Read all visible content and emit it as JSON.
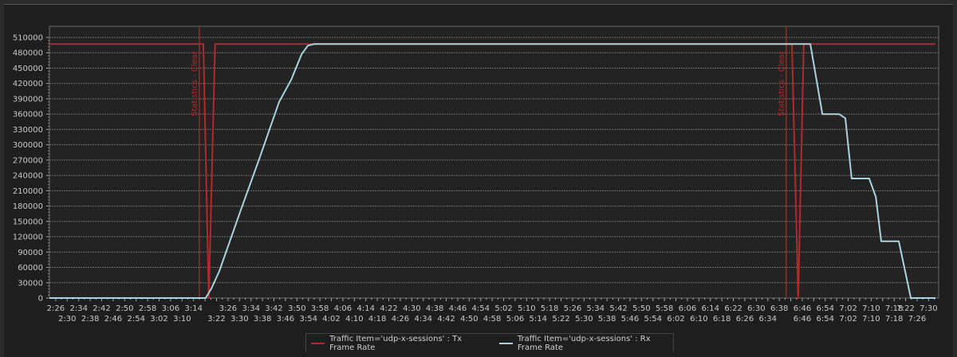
{
  "chart_data": {
    "type": "line",
    "title": "",
    "xlabel": "",
    "ylabel": "",
    "x_units": "minutes since 0:00",
    "xlim": [
      143.8,
      453.5
    ],
    "ylim": [
      0,
      527000
    ],
    "grid": true,
    "legend_position": "bottom-center",
    "yticks": [
      0,
      30000,
      60000,
      90000,
      120000,
      150000,
      180000,
      210000,
      240000,
      270000,
      300000,
      330000,
      360000,
      390000,
      420000,
      450000,
      480000,
      510000
    ],
    "xticks_row1": [
      "2:26",
      "2:34",
      "2:42",
      "2:50",
      "2:58",
      "3:06",
      "3:14",
      "3:26",
      "3:34",
      "3:42",
      "3:50",
      "3:58",
      "4:06",
      "4:14",
      "4:22",
      "4:30",
      "4:38",
      "4:46",
      "4:54",
      "5:02",
      "5:10",
      "5:18",
      "5:26",
      "5:34",
      "5:42",
      "5:50",
      "5:58",
      "6:06",
      "6:14",
      "6:22",
      "6:30",
      "6:38",
      "6:46",
      "6:54",
      "7:02",
      "7:10",
      "7:18",
      "7:22",
      "7:30"
    ],
    "xticks_row2": [
      "2:30",
      "2:38",
      "2:46",
      "2:54",
      "3:02",
      "3:10",
      "3:22",
      "3:30",
      "3:38",
      "3:46",
      "3:54",
      "4:02",
      "4:10",
      "4:18",
      "4:26",
      "4:34",
      "4:42",
      "4:50",
      "4:58",
      "5:06",
      "5:14",
      "5:22",
      "5:30",
      "5:38",
      "5:46",
      "5:54",
      "6:02",
      "6:10",
      "6:18",
      "6:26",
      "6:34",
      "6:46",
      "6:54",
      "7:02",
      "7:10",
      "7:18",
      "7:26"
    ],
    "markers": [
      {
        "x": 196,
        "label": "Statistics - Clear"
      },
      {
        "x": 400.4,
        "label": "Statistics - Clear"
      }
    ],
    "series": [
      {
        "name": "Traffic Item='udp-x-sessions' : Tx Frame Rate",
        "color": "#b22a2a",
        "points": [
          [
            143.8,
            497000
          ],
          [
            197.4,
            497000
          ],
          [
            199.3,
            0
          ],
          [
            201.5,
            497000
          ],
          [
            402.4,
            497000
          ],
          [
            404.6,
            0
          ],
          [
            406.5,
            497000
          ],
          [
            452.4,
            497000
          ]
        ]
      },
      {
        "name": "Traffic Item='udp-x-sessions' : Rx Frame Rate",
        "color": "#a8d4de",
        "points": [
          [
            143.8,
            0
          ],
          [
            198.2,
            0
          ],
          [
            200.2,
            18700
          ],
          [
            203,
            53000
          ],
          [
            210,
            165000
          ],
          [
            216.8,
            271000
          ],
          [
            223.8,
            384000
          ],
          [
            228,
            427000
          ],
          [
            231.6,
            477000
          ],
          [
            233.8,
            494000
          ],
          [
            236,
            497000
          ],
          [
            408.8,
            497000
          ],
          [
            413,
            360000
          ],
          [
            418.8,
            360000
          ],
          [
            421,
            352000
          ],
          [
            423.2,
            234000
          ],
          [
            429.3,
            234000
          ],
          [
            431.6,
            198000
          ],
          [
            433.5,
            111000
          ],
          [
            439.6,
            111000
          ],
          [
            443.8,
            0
          ],
          [
            452.4,
            0
          ]
        ]
      }
    ]
  }
}
